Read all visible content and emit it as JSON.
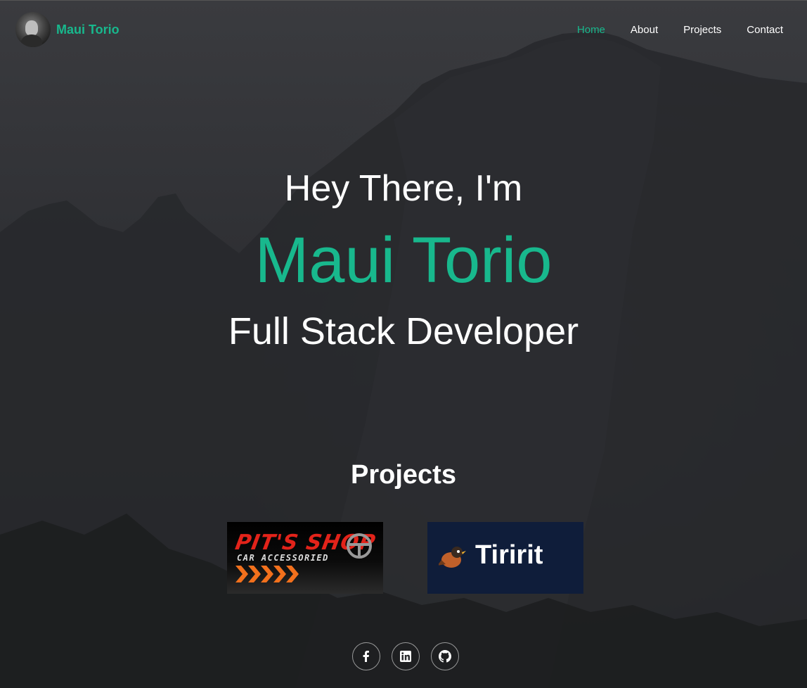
{
  "brand": {
    "name": "Maui Torio",
    "accent": "#18b88d"
  },
  "nav": {
    "items": [
      {
        "label": "Home",
        "active": true
      },
      {
        "label": "About",
        "active": false
      },
      {
        "label": "Projects",
        "active": false
      },
      {
        "label": "Contact",
        "active": false
      }
    ]
  },
  "intro": {
    "greeting": "Hey There, I'm",
    "name": "Maui Torio",
    "role": "Full Stack Developer"
  },
  "projects": {
    "title": "Projects",
    "cards": [
      {
        "logo_title": "PIT'S SHOP",
        "logo_subtitle": "CAR ACCESSORIED"
      },
      {
        "logo_title": "Tiririt"
      }
    ]
  },
  "social": {
    "links": [
      {
        "icon": "facebook-icon"
      },
      {
        "icon": "linkedin-icon"
      },
      {
        "icon": "github-icon"
      }
    ]
  }
}
